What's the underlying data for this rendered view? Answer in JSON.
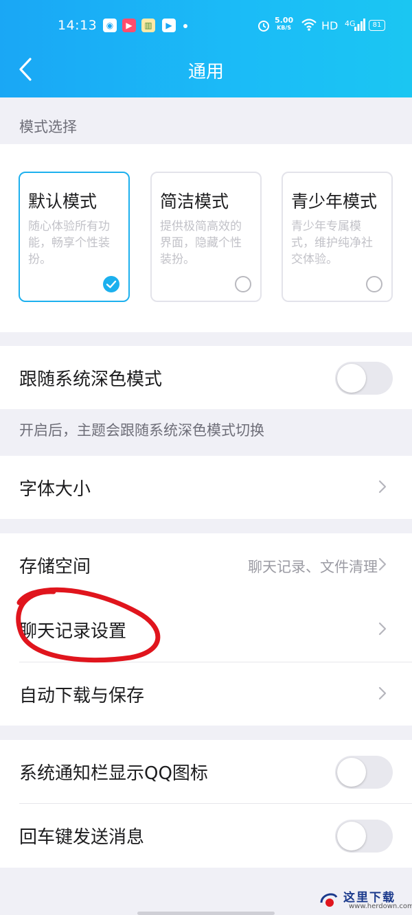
{
  "status_bar": {
    "time": "14:13",
    "net_speed": "5.00",
    "net_unit": "KB/S",
    "hd": "HD",
    "signal": "4G",
    "battery": "81"
  },
  "header": {
    "title": "通用"
  },
  "mode_section": {
    "label": "模式选择",
    "modes": [
      {
        "title": "默认模式",
        "desc": "随心体验所有功能，畅享个性装扮。",
        "selected": true
      },
      {
        "title": "简洁模式",
        "desc": "提供极简高效的界面，隐藏个性装扮。",
        "selected": false
      },
      {
        "title": "青少年模式",
        "desc": "青少年专属模式，维护纯净社交体验。",
        "selected": false
      }
    ]
  },
  "dark_mode": {
    "label": "跟随系统深色模式",
    "enabled": false,
    "hint": "开启后，主题会跟随系统深色模式切换"
  },
  "font_size": {
    "label": "字体大小"
  },
  "storage_group": {
    "storage": {
      "label": "存储空间",
      "value": "聊天记录、文件清理"
    },
    "chat_history": {
      "label": "聊天记录设置"
    },
    "auto_download": {
      "label": "自动下载与保存"
    }
  },
  "toggles_group": {
    "notification_icon": {
      "label": "系统通知栏显示QQ图标",
      "enabled": false
    },
    "enter_to_send": {
      "label": "回车键发送消息",
      "enabled": false
    }
  },
  "watermark": {
    "text": "这里下载",
    "url": "www.herdown.com"
  },
  "colors": {
    "accent": "#1cb0ee",
    "header": "#1aa7f5",
    "annotation": "#e0151d"
  }
}
